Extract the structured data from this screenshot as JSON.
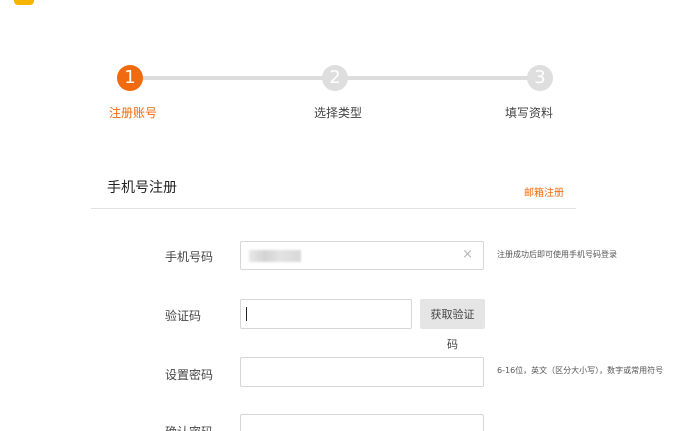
{
  "steps": [
    {
      "number": "1",
      "label": "注册账号",
      "active": true
    },
    {
      "number": "2",
      "label": "选择类型",
      "active": false
    },
    {
      "number": "3",
      "label": "填写资料",
      "active": false
    }
  ],
  "section": {
    "title": "手机号注册",
    "switch_link": "邮箱注册"
  },
  "form": {
    "phone": {
      "label": "手机号码",
      "clear_icon": "×",
      "hint": "注册成功后即可使用手机号码登录"
    },
    "code": {
      "label": "验证码",
      "value": "",
      "button_label": "获取验证码"
    },
    "password": {
      "label": "设置密码",
      "value": "",
      "hint": "6-16位，英文（区分大小写），数字或常用符号"
    },
    "confirm": {
      "label": "确认密码",
      "value": ""
    }
  },
  "colors": {
    "accent": "#f06a0f",
    "inactive_step": "#dedede"
  },
  "icons": {
    "clear": "close-icon",
    "logo": "logo-icon"
  }
}
